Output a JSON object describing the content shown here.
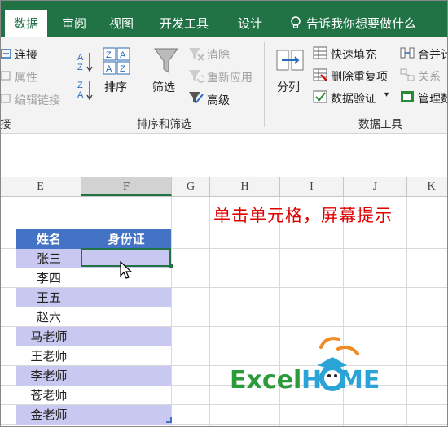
{
  "tabs": [
    {
      "label": "数据",
      "active": true
    },
    {
      "label": "审阅",
      "active": false
    },
    {
      "label": "视图",
      "active": false
    },
    {
      "label": "开发工具",
      "active": false
    },
    {
      "label": "设计",
      "active": false
    }
  ],
  "tell_me": "告诉我你想要做什么",
  "ribbon": {
    "connections": {
      "items": [
        "连接",
        "属性",
        "编辑链接"
      ],
      "group_label": "接"
    },
    "sort_filter": {
      "sort_label": "排序",
      "filter_label": "筛选",
      "clear_label": "清除",
      "reapply_label": "重新应用",
      "advanced_label": "高级",
      "group_label": "排序和筛选"
    },
    "data_tools": {
      "text_to_columns": "分列",
      "flash_fill": "快速填充",
      "remove_duplicates": "删除重复项",
      "data_validation": "数据验证",
      "consolidate": "合并计",
      "relationships": "关系",
      "manage_model": "管理数",
      "group_label": "数据工具"
    }
  },
  "columns": [
    "E",
    "F",
    "G",
    "H",
    "I",
    "J",
    "K"
  ],
  "selected_column": "F",
  "table": {
    "headers": [
      "姓名",
      "身份证"
    ],
    "rows": [
      "张三",
      "李四",
      "王五",
      "赵六",
      "马老师",
      "王老师",
      "李老师",
      "苍老师",
      "金老师"
    ]
  },
  "annotation": "单击单元格，屏幕提示",
  "logo": {
    "left": "Excel",
    "right": "H  ME"
  },
  "colors": {
    "accent": "#217346",
    "header_fill": "#4472c4",
    "band_fill": "#c8c8f0",
    "note": "#e00000"
  }
}
